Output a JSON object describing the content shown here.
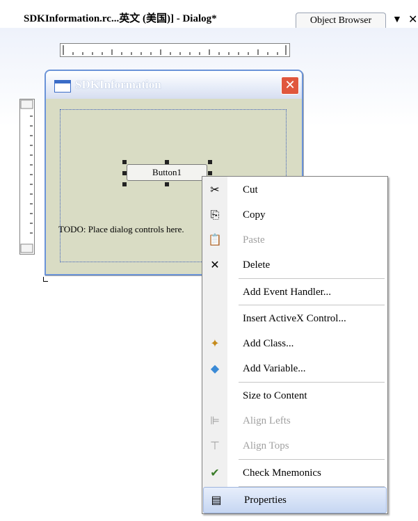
{
  "tabs": {
    "active": "SDKInformation.rc...英文 (美国)] - Dialog*",
    "inactive": "Object Browser",
    "dropdown_glyph": "▼",
    "close_glyph": "✕"
  },
  "dialog": {
    "title": "SDKInformation",
    "close_glyph": "✕",
    "button_label": "Button1",
    "todo_text": "TODO: Place dialog controls here."
  },
  "context_menu": {
    "items": [
      {
        "label": "Cut",
        "icon": "scissors-icon",
        "glyph": "✂",
        "disabled": false
      },
      {
        "label": "Copy",
        "icon": "copy-icon",
        "glyph": "⎘",
        "disabled": false
      },
      {
        "label": "Paste",
        "icon": "paste-icon",
        "glyph": "📋",
        "disabled": true
      },
      {
        "label": "Delete",
        "icon": "delete-icon",
        "glyph": "✕",
        "disabled": false
      },
      {
        "label": "Add Event Handler...",
        "icon": "",
        "glyph": "",
        "disabled": false
      },
      {
        "label": "Insert ActiveX Control...",
        "icon": "",
        "glyph": "",
        "disabled": false
      },
      {
        "label": "Add Class...",
        "icon": "add-class-icon",
        "glyph": "✦",
        "disabled": false
      },
      {
        "label": "Add Variable...",
        "icon": "add-variable-icon",
        "glyph": "◆",
        "disabled": false
      },
      {
        "label": "Size to Content",
        "icon": "",
        "glyph": "",
        "disabled": false
      },
      {
        "label": "Align Lefts",
        "icon": "align-lefts-icon",
        "glyph": "⊫",
        "disabled": true
      },
      {
        "label": "Align Tops",
        "icon": "align-tops-icon",
        "glyph": "⊤",
        "disabled": true
      },
      {
        "label": "Check Mnemonics",
        "icon": "check-mnemonics-icon",
        "glyph": "✔",
        "disabled": false
      },
      {
        "label": "Properties",
        "icon": "properties-icon",
        "glyph": "▤",
        "disabled": false
      }
    ]
  },
  "colors": {
    "dialog_border": "#6a93d8",
    "dialog_body": "#d9dcc4",
    "close_button": "#e0573d",
    "selection": "#c6d6f2"
  }
}
